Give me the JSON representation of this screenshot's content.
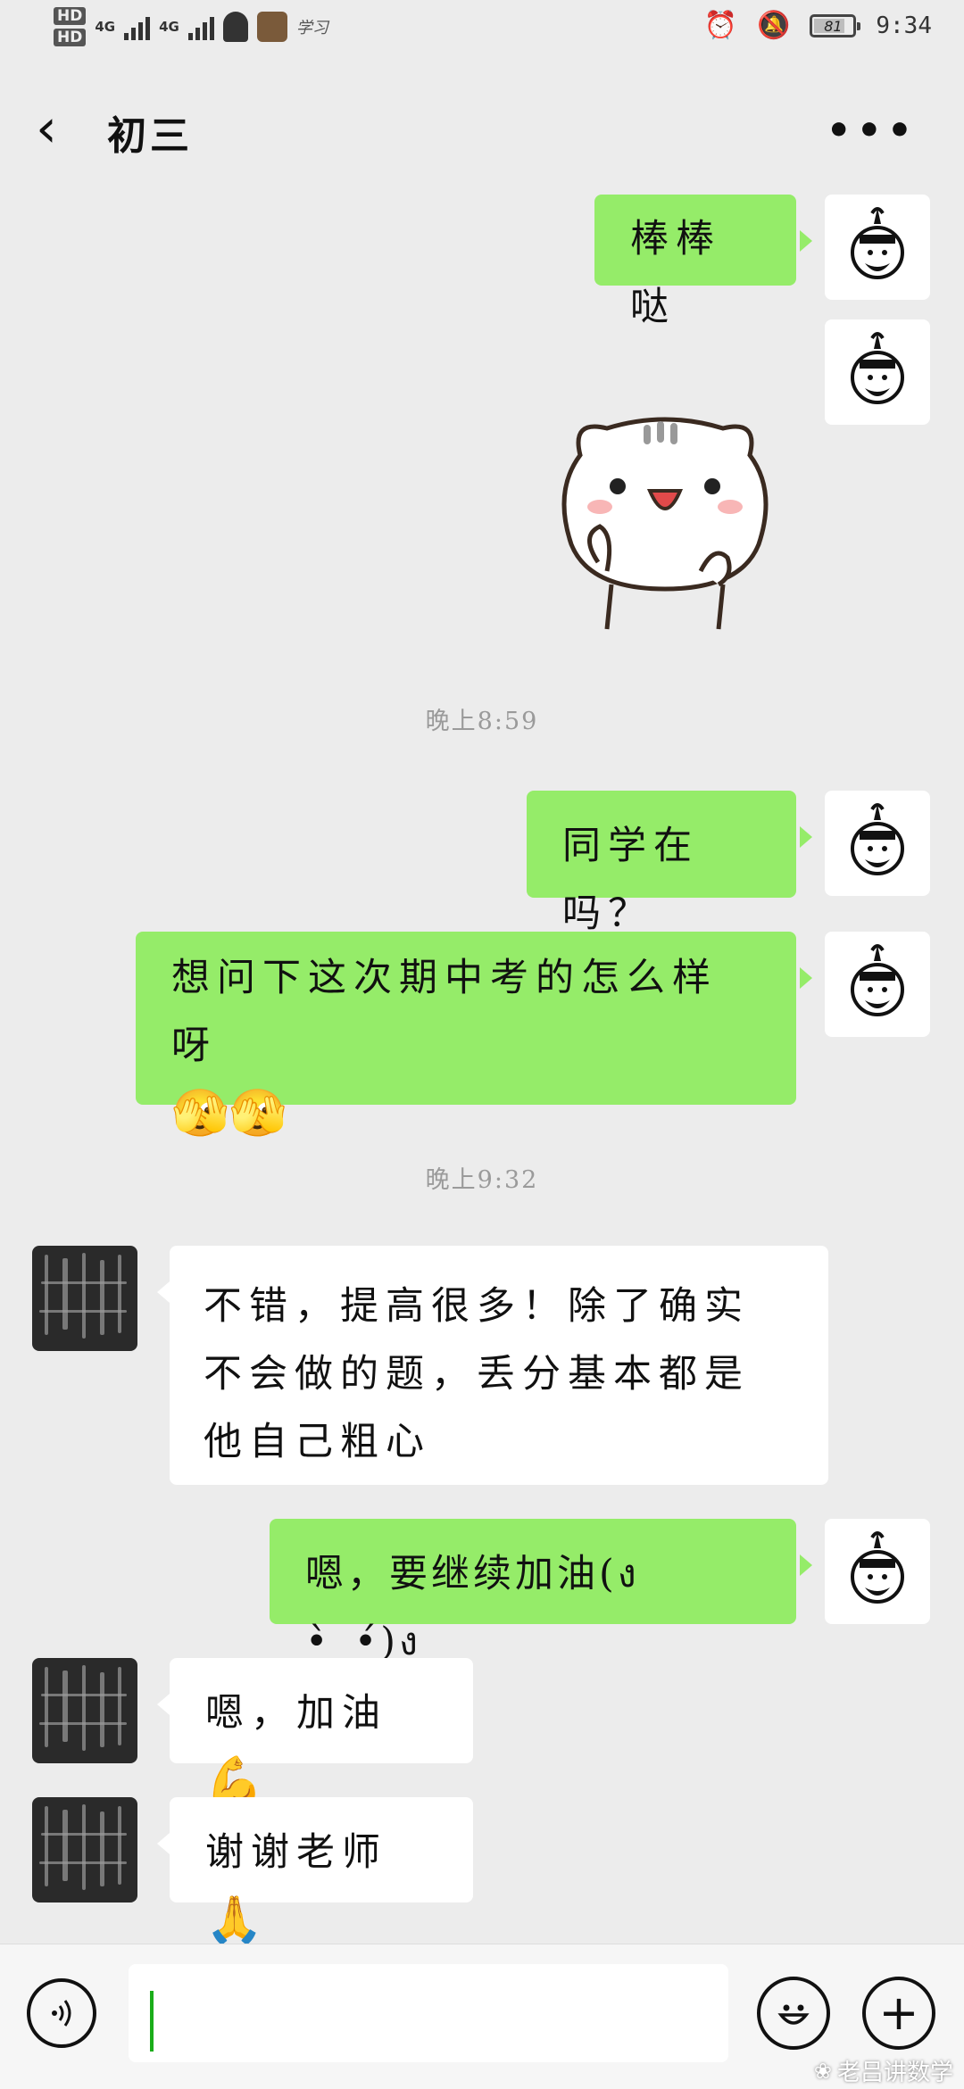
{
  "status_bar": {
    "hd1": "HD",
    "hd2": "HD",
    "net1": "4G",
    "net2": "4G",
    "small_text": "学习",
    "battery": "81",
    "battery_level": 0.81,
    "time": "9:34",
    "icons": [
      "alarm-icon",
      "notifications-off-icon"
    ]
  },
  "header": {
    "back_icon": "‹",
    "title": "初三",
    "more_icon": "•••"
  },
  "messages": [
    {
      "side": "me",
      "text": "棒棒哒"
    },
    {
      "side": "me",
      "type": "sticker",
      "sticker": "white-cat-sticker"
    },
    {
      "type": "timestamp",
      "text": "晚上8:59"
    },
    {
      "side": "me",
      "text": "同学在吗？"
    },
    {
      "side": "me",
      "text": "想问下这次期中考的怎么样呀",
      "emoji": "🫣🫣"
    },
    {
      "type": "timestamp",
      "text": "晚上9:32"
    },
    {
      "side": "them",
      "text": "不错，提高很多！除了确实不会做的题，丢分基本都是他自己粗心"
    },
    {
      "side": "me",
      "text": "嗯，要继续加油(ง •̀_•́)ง"
    },
    {
      "side": "them",
      "text": "嗯，加油",
      "emoji": "💪"
    },
    {
      "side": "them",
      "text": "谢谢老师",
      "emoji": "🙏"
    }
  ],
  "input_bar": {
    "voice_icon": "voice-icon",
    "input_value": "",
    "emoji_icon": "😁",
    "plus_icon": "+"
  },
  "watermark": {
    "text": "老吕讲数学"
  },
  "colors": {
    "my_bubble": "#95ec69",
    "their_bubble": "#ffffff",
    "background": "#ececec",
    "caret": "#1aad19"
  }
}
